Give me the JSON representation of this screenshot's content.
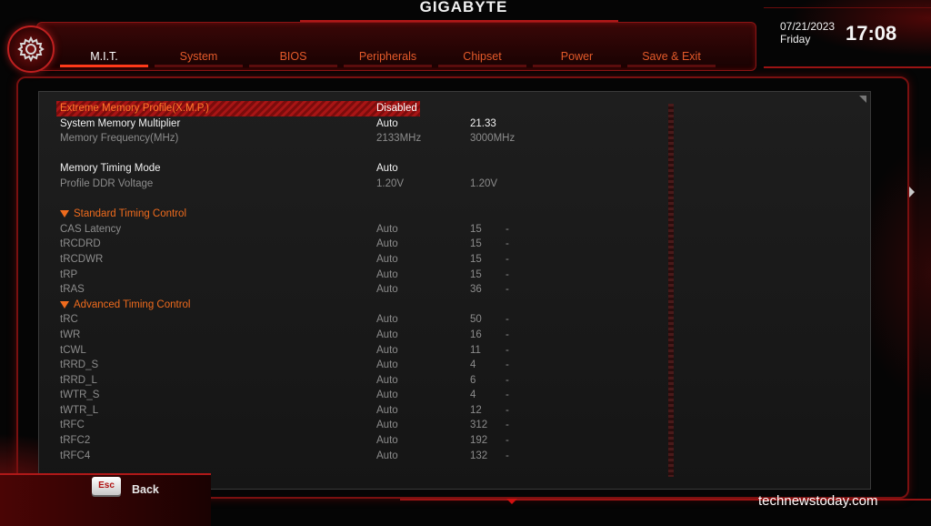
{
  "header": {
    "brand": "GIGABYTE",
    "date": "07/21/2023",
    "day": "Friday",
    "time": "17:08"
  },
  "tabs": [
    {
      "label": "M.I.T.",
      "active": true
    },
    {
      "label": "System",
      "active": false
    },
    {
      "label": "BIOS",
      "active": false
    },
    {
      "label": "Peripherals",
      "active": false
    },
    {
      "label": "Chipset",
      "active": false
    },
    {
      "label": "Power",
      "active": false
    },
    {
      "label": "Save & Exit",
      "active": false
    }
  ],
  "settings": [
    {
      "type": "highlight",
      "label": "Extreme Memory Profile(X.M.P.)",
      "current": "Disabled",
      "value": "",
      "dash": ""
    },
    {
      "type": "white",
      "label": "System Memory Multiplier",
      "current": "Auto",
      "value": "21.33",
      "dash": ""
    },
    {
      "type": "grey",
      "label": "Memory Frequency(MHz)",
      "current": "2133MHz",
      "value": "3000MHz",
      "dash": ""
    },
    {
      "type": "spacer"
    },
    {
      "type": "white",
      "label": "Memory Timing Mode",
      "current": "Auto",
      "value": "",
      "dash": ""
    },
    {
      "type": "grey",
      "label": "Profile DDR Voltage",
      "current": "1.20V",
      "value": "1.20V",
      "dash": ""
    },
    {
      "type": "spacer"
    },
    {
      "type": "section",
      "label": "Standard Timing Control"
    },
    {
      "type": "grey",
      "label": "CAS Latency",
      "current": "Auto",
      "value": "15",
      "dash": "-"
    },
    {
      "type": "grey",
      "label": "tRCDRD",
      "current": "Auto",
      "value": "15",
      "dash": "-"
    },
    {
      "type": "grey",
      "label": "tRCDWR",
      "current": "Auto",
      "value": "15",
      "dash": "-"
    },
    {
      "type": "grey",
      "label": "tRP",
      "current": "Auto",
      "value": "15",
      "dash": "-"
    },
    {
      "type": "grey",
      "label": "tRAS",
      "current": "Auto",
      "value": "36",
      "dash": "-"
    },
    {
      "type": "section",
      "label": "Advanced Timing Control"
    },
    {
      "type": "grey",
      "label": "tRC",
      "current": "Auto",
      "value": "50",
      "dash": "-"
    },
    {
      "type": "grey",
      "label": "tWR",
      "current": "Auto",
      "value": "16",
      "dash": "-"
    },
    {
      "type": "grey",
      "label": "tCWL",
      "current": "Auto",
      "value": "11",
      "dash": "-"
    },
    {
      "type": "grey",
      "label": "tRRD_S",
      "current": "Auto",
      "value": "4",
      "dash": "-"
    },
    {
      "type": "grey",
      "label": "tRRD_L",
      "current": "Auto",
      "value": "6",
      "dash": "-"
    },
    {
      "type": "grey",
      "label": "tWTR_S",
      "current": "Auto",
      "value": "4",
      "dash": "-"
    },
    {
      "type": "grey",
      "label": "tWTR_L",
      "current": "Auto",
      "value": "12",
      "dash": "-"
    },
    {
      "type": "grey",
      "label": "tRFC",
      "current": "Auto",
      "value": "312",
      "dash": "-"
    },
    {
      "type": "grey",
      "label": "tRFC2",
      "current": "Auto",
      "value": "192",
      "dash": "-"
    },
    {
      "type": "grey",
      "label": "tRFC4",
      "current": "Auto",
      "value": "132",
      "dash": "-"
    }
  ],
  "footer": {
    "esc_key": "Esc",
    "back_label": "Back",
    "watermark": "technewstoday.com"
  },
  "colors": {
    "accent": "#ef6b1d",
    "frame_red": "#b01818",
    "highlight_red": "#a81515"
  }
}
